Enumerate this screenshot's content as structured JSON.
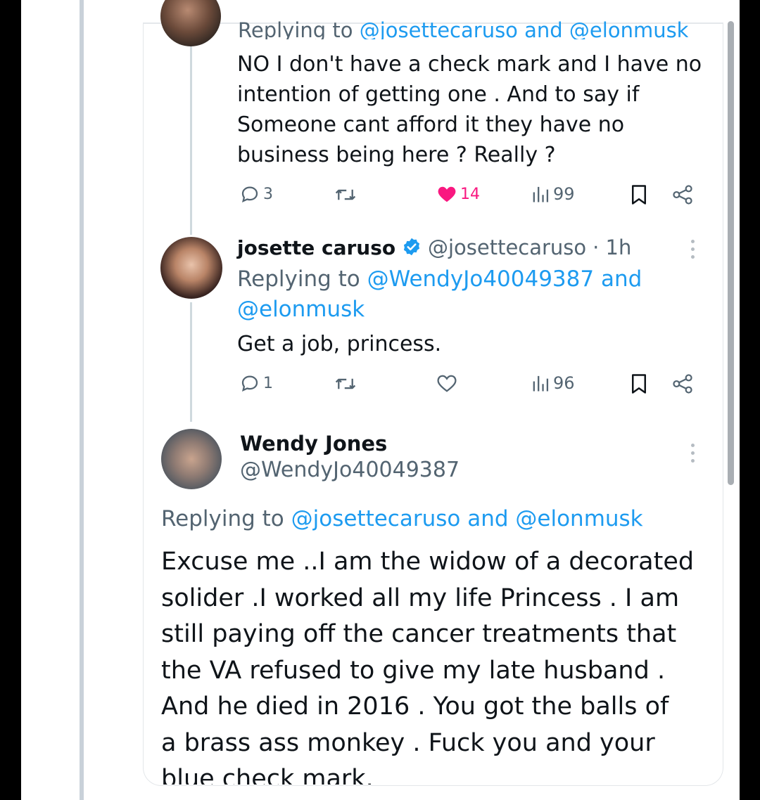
{
  "tweet1": {
    "reply_prefix": "Replying to ",
    "reply_user1": "@josettecaruso",
    "reply_and": " and ",
    "reply_user2": "@elonmusk",
    "body_lines": [
      "NO I don't have a check mark and I have no",
      "intention of getting one . And to say if",
      "Someone cant afford it  they have no",
      "business being here ? Really ?"
    ],
    "replies": "3",
    "likes": "14",
    "views": "99"
  },
  "tweet2": {
    "name": "josette caruso",
    "handle": "@josettecaruso",
    "time": "· 1h",
    "reply_prefix": "Replying to ",
    "reply_user1": "@WendyJo40049387",
    "reply_and": " and",
    "reply_user2": "@elonmusk",
    "body": "Get a job, princess.",
    "replies": "1",
    "views": "96"
  },
  "tweet3": {
    "name": "Wendy Jones",
    "handle": "@WendyJo40049387",
    "reply_prefix": "Replying to ",
    "reply_user1": "@josettecaruso",
    "reply_and": " and ",
    "reply_user2": "@elonmusk",
    "body_lines": [
      "Excuse me ..I am the widow of a decorated",
      "solider .I worked all my life Princess . I am",
      "still paying off the cancer treatments that",
      "the VA refused to give my late husband .",
      "And he died in 2016 . You got the balls of",
      "a brass ass monkey .   Fuck you and your",
      "blue check mark."
    ]
  },
  "icons": {
    "reply": "comment-bubble-icon",
    "retweet": "retweet-icon",
    "like": "heart-icon",
    "views": "bar-chart-icon",
    "bookmark": "bookmark-icon",
    "share": "share-icon",
    "verified": "verified-badge-icon",
    "more": "more-vertical-icon"
  },
  "colors": {
    "link": "#1d9bf0",
    "like": "#f91880",
    "muted": "#536471",
    "verified": "#1d9bf0"
  }
}
